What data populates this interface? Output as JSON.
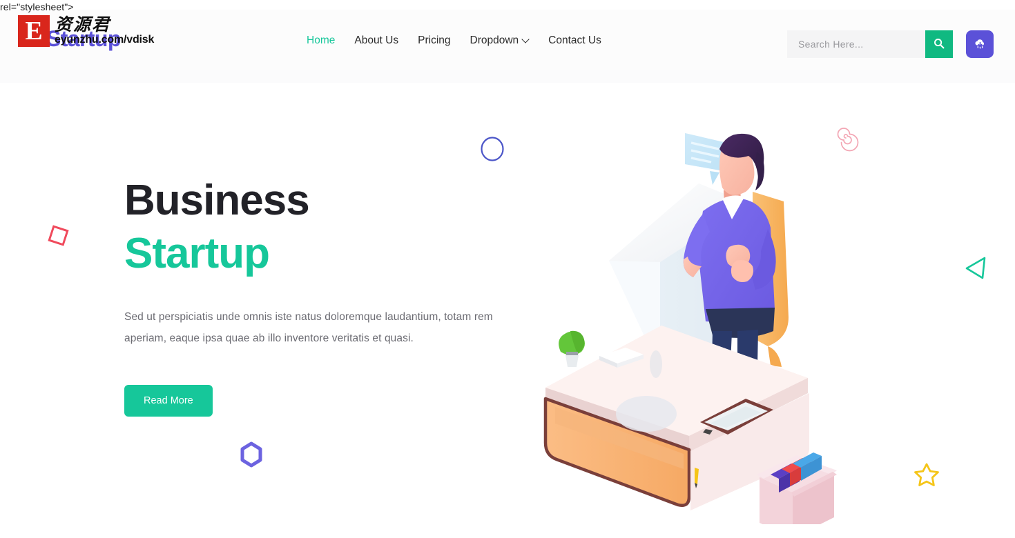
{
  "source_text": "rel=\"stylesheet\">",
  "watermark": {
    "badge_letter": "E",
    "cn_text": "资源君",
    "url": "eyunzhu.com/vdisk"
  },
  "header": {
    "logo_text": "Startup",
    "logo_icon": "chevrons-logo-icon",
    "nav": [
      {
        "label": "Home",
        "active": true
      },
      {
        "label": "About Us",
        "active": false
      },
      {
        "label": "Pricing",
        "active": false
      },
      {
        "label": "Dropdown",
        "active": false,
        "has_chevron": true
      },
      {
        "label": "Contact Us",
        "active": false
      }
    ],
    "search": {
      "placeholder": "Search Here...",
      "value": "",
      "button_icon": "search-icon"
    },
    "download_button_icon": "cloud-download-icon"
  },
  "hero": {
    "title_line1": "Business",
    "title_line2": "Startup",
    "paragraph": "Sed ut perspiciatis unde omnis iste natus doloremque laudantium, totam rem aperiam, eaque ipsa quae ab illo inventore veritatis et quasi.",
    "cta_label": "Read More",
    "illustration_alt": "isometric-man-at-desk-illustration"
  },
  "decorations": [
    {
      "name": "diamond-outline",
      "color": "#f04a5c"
    },
    {
      "name": "circle-outline",
      "color": "#4b55c8"
    },
    {
      "name": "spiral-outline",
      "color": "#f3a6b4"
    },
    {
      "name": "triangle-outline",
      "color": "#16c79a"
    },
    {
      "name": "star-outline",
      "color": "#f5c518"
    },
    {
      "name": "hexagon-outline",
      "color": "#6c63e0"
    }
  ],
  "colors": {
    "accent_green": "#16c79a",
    "accent_purple": "#5b51d8",
    "heading_dark": "#222228",
    "body_text": "#6b6b72",
    "header_bg": "#fcfcfc",
    "input_bg": "#f4f4f5"
  }
}
